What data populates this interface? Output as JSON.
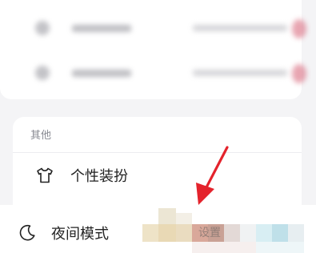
{
  "settings_list": {
    "other_section": {
      "header": "其他",
      "items": [
        {
          "label": "个性装扮",
          "icon": "tshirt-icon"
        },
        {
          "label": "夜间模式",
          "icon": "moon-icon"
        }
      ]
    },
    "partial_text": "设置"
  },
  "colors": {
    "arrow": "#e4232c",
    "text": "#222222",
    "section_header": "#888a92",
    "page_background": "#f4f4f6"
  }
}
